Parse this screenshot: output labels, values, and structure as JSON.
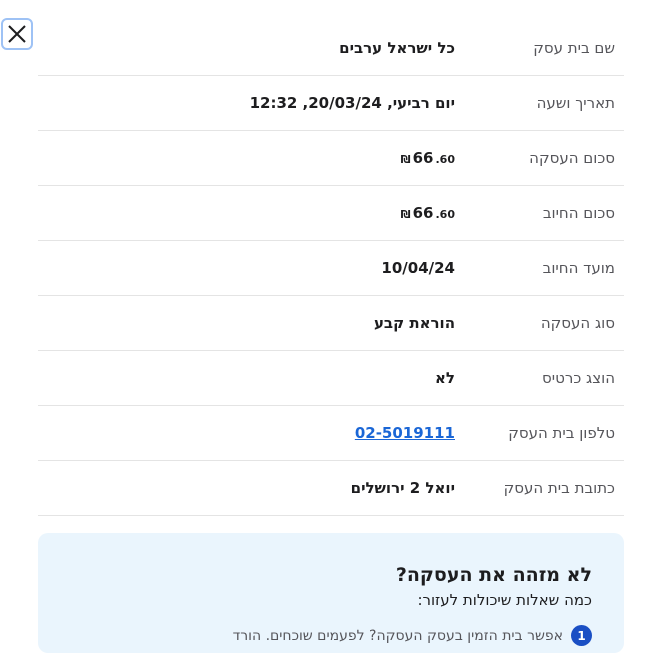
{
  "rows": [
    {
      "label": "שם בית עסק",
      "value": "כל ישראל ערבים"
    },
    {
      "label": "תאריך ושעה",
      "value": "יום רביעי, 20/03/24, 12:32"
    },
    {
      "label": "סכום העסקה",
      "amount": {
        "currency": "₪",
        "integer": "66",
        "decimal": ".60"
      }
    },
    {
      "label": "סכום החיוב",
      "amount": {
        "currency": "₪",
        "integer": "66",
        "decimal": ".60"
      }
    },
    {
      "label": "מועד החיוב",
      "value": "10/04/24"
    },
    {
      "label": "סוג העסקה",
      "value": "הוראת קבע"
    },
    {
      "label": "הוצג כרטיס",
      "value": "לא"
    },
    {
      "label": "טלפון בית העסק",
      "value": "02-5019111"
    },
    {
      "label": "כתובת בית העסק",
      "value": "יואל 2 ירושלים"
    }
  ],
  "help": {
    "title": "לא מזהה את העסקה?",
    "subtitle": "כמה שאלות שיכולות לעזור:",
    "question_number": "1",
    "question_text": "אפשר בית הזמין בעסק העסקה? לפעמים שוכחים. הורד"
  },
  "icons": {
    "close": "close-icon"
  },
  "colors": {
    "link": "#1a66d6",
    "help_bg": "#eaf5fd",
    "badge": "#1a4fc4"
  }
}
